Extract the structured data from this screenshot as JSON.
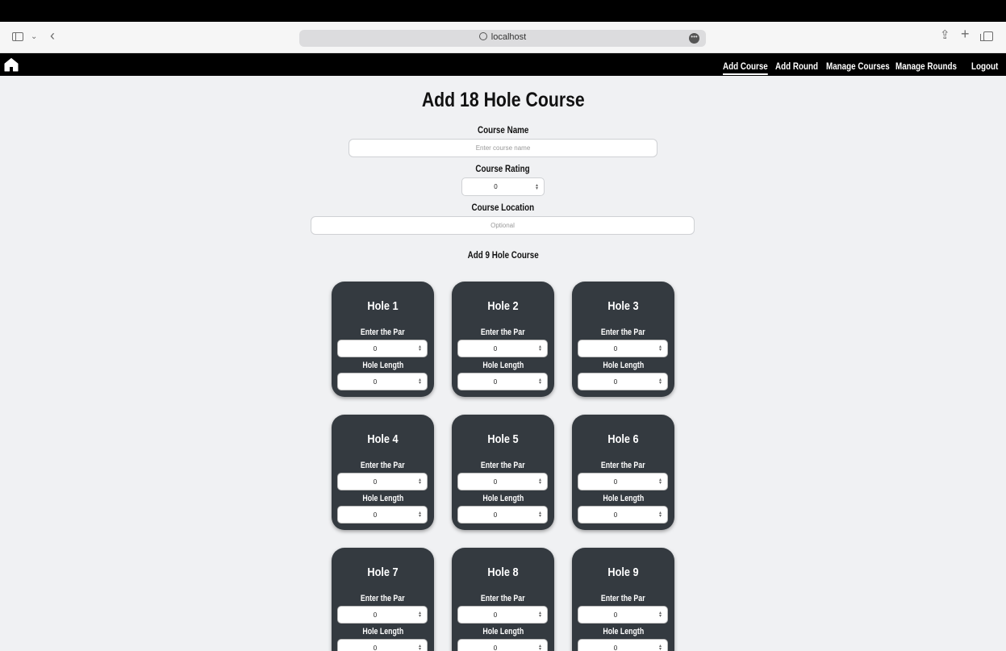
{
  "browser": {
    "url": "localhost"
  },
  "nav": {
    "items": [
      "Add Course",
      "Add Round",
      "Manage Courses",
      "Manage Rounds",
      "Logout"
    ],
    "active": "Add Course"
  },
  "form": {
    "title": "Add 18 Hole Course",
    "course_name_label": "Course Name",
    "course_name_placeholder": "Enter course name",
    "course_rating_label": "Course Rating",
    "course_rating_value": "0",
    "course_location_label": "Course Location",
    "course_location_placeholder": "Optional",
    "toggle_link": "Add 9 Hole Course"
  },
  "holes": [
    {
      "title": "Hole 1",
      "par_label": "Enter the Par",
      "par": "0",
      "length_label": "Hole Length",
      "length": "0"
    },
    {
      "title": "Hole 2",
      "par_label": "Enter the Par",
      "par": "0",
      "length_label": "Hole Length",
      "length": "0"
    },
    {
      "title": "Hole 3",
      "par_label": "Enter the Par",
      "par": "0",
      "length_label": "Hole Length",
      "length": "0"
    },
    {
      "title": "Hole 4",
      "par_label": "Enter the Par",
      "par": "0",
      "length_label": "Hole Length",
      "length": "0"
    },
    {
      "title": "Hole 5",
      "par_label": "Enter the Par",
      "par": "0",
      "length_label": "Hole Length",
      "length": "0"
    },
    {
      "title": "Hole 6",
      "par_label": "Enter the Par",
      "par": "0",
      "length_label": "Hole Length",
      "length": "0"
    },
    {
      "title": "Hole 7",
      "par_label": "Enter the Par",
      "par": "0",
      "length_label": "Hole Length",
      "length": "0"
    },
    {
      "title": "Hole 8",
      "par_label": "Enter the Par",
      "par": "0",
      "length_label": "Hole Length",
      "length": "0"
    },
    {
      "title": "Hole 9",
      "par_label": "Enter the Par",
      "par": "0",
      "length_label": "Hole Length",
      "length": "0"
    }
  ],
  "colors": {
    "page_bg": "#f0f1f3",
    "card_bg": "#343a40",
    "navbar_bg": "#000000"
  }
}
